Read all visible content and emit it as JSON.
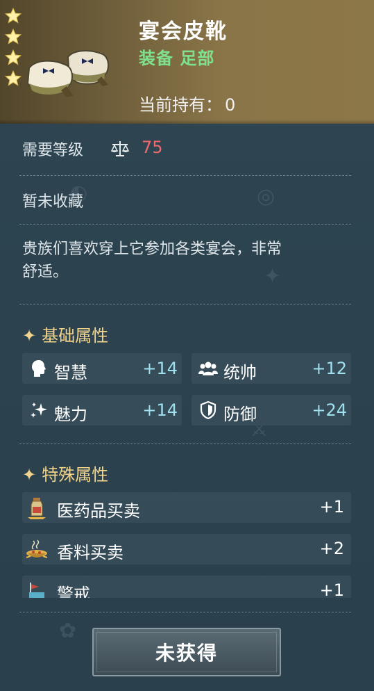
{
  "item": {
    "name": "宴会皮靴",
    "category": "装备 足部",
    "holding_label": "当前持有：",
    "holding_count": "0",
    "stars": 4,
    "icon": "leather-shoes-icon"
  },
  "requirements": {
    "level_label": "需要等级",
    "level_icon": "scale-icon",
    "level_value": "75"
  },
  "collection_status": "暂未收藏",
  "description_lines": [
    "贵族们喜欢穿上它参加各类宴会，非常",
    "舒适。"
  ],
  "base_attributes": {
    "title": "基础属性",
    "items": [
      {
        "icon": "head-icon",
        "name": "智慧",
        "value": "+14"
      },
      {
        "icon": "people-icon",
        "name": "统帅",
        "value": "+12"
      },
      {
        "icon": "sparkle-icon",
        "name": "魅力",
        "value": "+14"
      },
      {
        "icon": "shield-icon",
        "name": "防御",
        "value": "+24"
      }
    ]
  },
  "special_attributes": {
    "title": "特殊属性",
    "items": [
      {
        "icon": "medicine-bottle-icon",
        "name": "医药品买卖",
        "value": "+1"
      },
      {
        "icon": "spice-bowl-icon",
        "name": "香料买卖",
        "value": "+2"
      },
      {
        "icon": "lookout-icon",
        "name": "警戒",
        "value": "+1"
      }
    ]
  },
  "action_button": "未获得",
  "colors": {
    "header_gold": "#8a7548",
    "category_green": "#7fe08f",
    "level_red": "#ef6a6a",
    "section_gold": "#f2d48c",
    "stat_value_cyan": "#9fe0ef",
    "panel_bg": "#2e4652"
  }
}
